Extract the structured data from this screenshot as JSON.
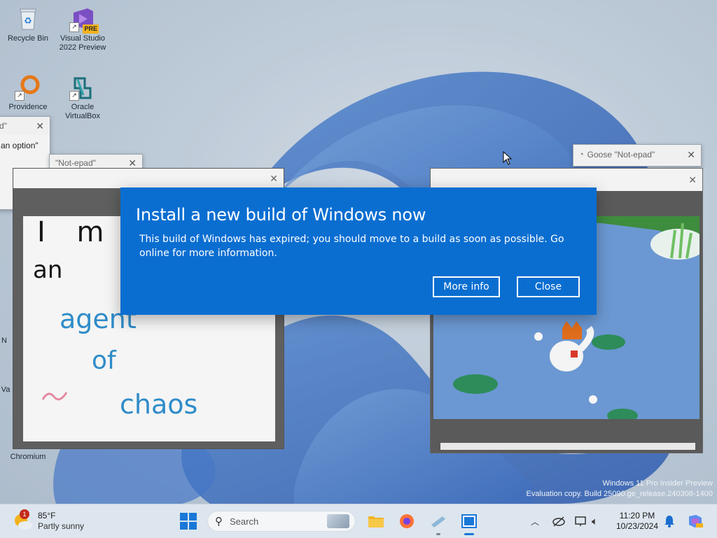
{
  "desktop": {
    "icons": [
      {
        "label": "Recycle Bin",
        "icon": "recycle-bin-icon"
      },
      {
        "label": "Visual Studio 2022 Preview",
        "badge": "PRE",
        "icon": "visual-studio-icon"
      },
      {
        "label": "Providence",
        "icon": "magnifier-app-icon"
      },
      {
        "label": "Oracle VirtualBox",
        "icon": "virtualbox-icon"
      },
      {
        "label": "N",
        "icon": "partial-icon"
      },
      {
        "label": "Va",
        "icon": "partial-icon"
      },
      {
        "label": "Chromium",
        "icon": "chromium-icon"
      }
    ]
  },
  "windows": {
    "left_popup": {
      "title": "d\"",
      "body": "an option\""
    },
    "notepad_small": {
      "title": "\"Not-epad\""
    },
    "goose_notepad": {
      "title": "Goose \"Not-epad\""
    },
    "drawing": {
      "lines": [
        "I m",
        "an",
        "agent",
        "of",
        "chaos"
      ]
    }
  },
  "dialog": {
    "title": "Install a new build of Windows now",
    "message": "This build of Windows has expired; you should move to a build as soon as possible. Go online for more information.",
    "more_info_label": "More info",
    "close_label": "Close",
    "background": "#0a6ed1"
  },
  "watermark": {
    "line1": "Windows 11 Pro Insider Preview",
    "line2": "Evaluation copy. Build 25090.ge_release.240308-1400"
  },
  "taskbar": {
    "weather": {
      "temp": "85°F",
      "condition": "Partly sunny",
      "badge": "1"
    },
    "search_placeholder": "Search",
    "time": "11:20 PM",
    "date": "10/23/2024"
  }
}
